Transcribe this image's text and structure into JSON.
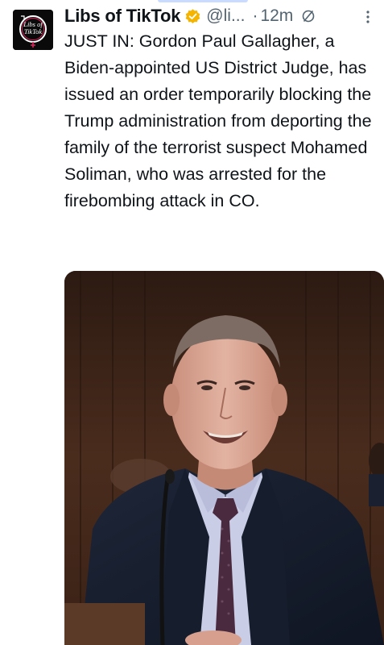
{
  "tweet": {
    "author_name": "Libs of TikTok",
    "handle": "@li...",
    "separator": "·",
    "time": "12m",
    "body": "JUST IN: Gordon Paul Gallagher, a Biden-appointed US District Judge, has issued an order temporarily blocking the Trump administration from deporting the family of the terrorist suspect Mohamed Soliman, who was arrested for the firebombing attack in CO."
  },
  "avatar": {
    "logo_line1": "Libs of",
    "logo_line2": "TikTok"
  },
  "icons": {
    "verified": "verified-badge-icon",
    "no_sign": "no-sign-icon",
    "more": "more-vertical-icon"
  },
  "colors": {
    "verified": "#f4b400",
    "secondary_text": "#536471",
    "text": "#0f1419"
  }
}
